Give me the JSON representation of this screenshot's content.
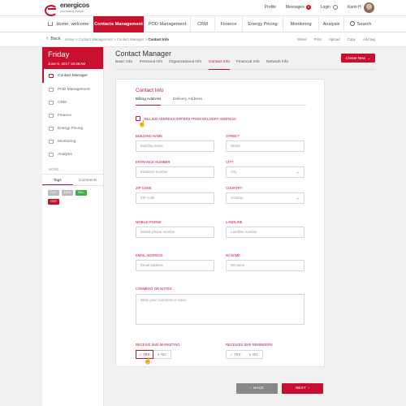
{
  "brand": {
    "name": "energicos",
    "tagline": "purchasing analytic"
  },
  "topbar": {
    "profile": "Profile",
    "messages": "Messages",
    "messages_count": "3",
    "login": "Login",
    "user": "Karin H."
  },
  "nav": {
    "home": "Home, welcome",
    "contacts": "Contacts Management",
    "pod": "POD Management",
    "crm": "CRM",
    "finance": "Finance",
    "energy": "Energy Pricing",
    "monitoring": "Monitoring",
    "analysis": "Analysis",
    "search": "Search"
  },
  "breadcrumb": {
    "back": "Back",
    "path": "Home > Contact Management > Contact Manager > ",
    "current": "Contact Info"
  },
  "actions": {
    "share": "Share",
    "print": "Print",
    "upload": "Upload",
    "copy": "Copy",
    "addtag": "Add tag"
  },
  "sidebar": {
    "day": "Friday",
    "date": "June 9, 2017   18:36AM",
    "items": [
      "Contact Manager",
      "POD Management",
      "CRM",
      "Finance",
      "Energy Pricing",
      "Monitoring",
      "Analysis"
    ],
    "more": "MORE",
    "tabs": [
      "Tags",
      "Comments"
    ],
    "tags": [
      {
        "label": "CEO",
        "color": "#bbbbbb"
      },
      {
        "label": "MGN",
        "color": "#bbbbbb"
      },
      {
        "label": "BILL",
        "color": "#3cb14a"
      },
      {
        "label": "OVR",
        "color": "#c8102e"
      }
    ]
  },
  "content": {
    "title": "Contact Manager",
    "create": "Create New",
    "tabs": [
      "Basic Info",
      "Personal Info",
      "Organizational Info",
      "Contact Info",
      "Financial Info",
      "Network Info"
    ]
  },
  "form": {
    "title": "Contact Info",
    "tabs": [
      "Billing Address",
      "Delivery Address"
    ],
    "billing_differs": "BILLING ADDRESS DIFFERS FROM DELIVERY ADDRESS",
    "fields": {
      "building_name": {
        "label": "BUILDING NAME",
        "placeholder": "Building name"
      },
      "street": {
        "label": "STREET",
        "placeholder": "Street"
      },
      "entrance_number": {
        "label": "ENTRANCE NUMBER",
        "placeholder": "Entrance number"
      },
      "city": {
        "label": "CITY",
        "placeholder": "City"
      },
      "zip_code": {
        "label": "ZIP CODE",
        "placeholder": "ZIP code"
      },
      "country": {
        "label": "COUNTRY",
        "placeholder": "Country"
      },
      "mobile_phone": {
        "label": "MOBILE PHONE",
        "placeholder": "Mobile phone number"
      },
      "landline": {
        "label": "LANDLINE",
        "placeholder": "Landline number"
      },
      "email": {
        "label": "EMAIL ADDRESS",
        "placeholder": "Email address"
      },
      "im_name": {
        "label": "IM NAME",
        "placeholder": "IM name"
      },
      "comment": {
        "label": "COMMENT OR NOTES",
        "placeholder": "Write your comment or notes"
      }
    },
    "sms_marketing": {
      "label": "RECEIVE SMS MARKETING",
      "yes": "YES",
      "no": "NO",
      "selected": "YES"
    },
    "sms_reminders": {
      "label": "RECEIVES SMS REMINDERS",
      "yes": "YES",
      "no": "NO"
    }
  },
  "buttons": {
    "back": "BACK",
    "next": "NEXT"
  }
}
